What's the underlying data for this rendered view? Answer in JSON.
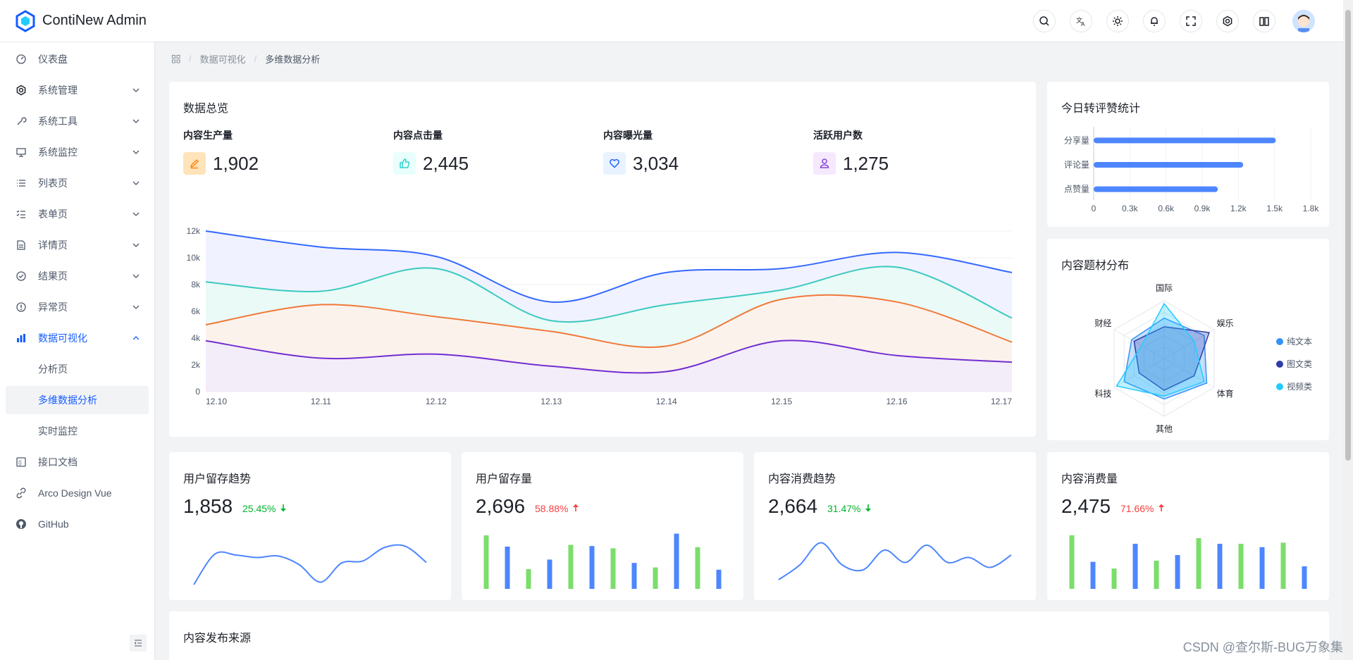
{
  "app": {
    "title": "ContiNew Admin"
  },
  "header": {
    "icons": [
      "search-icon",
      "translate-icon",
      "theme-icon",
      "bell-icon",
      "fullscreen-icon",
      "gear-icon",
      "book-icon"
    ]
  },
  "sidebar": {
    "items": [
      {
        "label": "仪表盘",
        "icon": "dashboard-icon"
      },
      {
        "label": "系统管理",
        "icon": "gear-icon"
      },
      {
        "label": "系统工具",
        "icon": "wrench-icon"
      },
      {
        "label": "系统监控",
        "icon": "monitor-icon"
      },
      {
        "label": "列表页",
        "icon": "list-icon"
      },
      {
        "label": "表单页",
        "icon": "form-icon"
      },
      {
        "label": "详情页",
        "icon": "file-icon"
      },
      {
        "label": "结果页",
        "icon": "check-circle-icon"
      },
      {
        "label": "异常页",
        "icon": "exclamation-icon"
      },
      {
        "label": "数据可视化",
        "icon": "bar-chart-icon"
      },
      {
        "label": "分析页"
      },
      {
        "label": "多维数据分析"
      },
      {
        "label": "实时监控"
      },
      {
        "label": "接口文档",
        "icon": "api-icon"
      },
      {
        "label": "Arco Design Vue",
        "icon": "link-icon"
      },
      {
        "label": "GitHub",
        "icon": "github-icon"
      }
    ]
  },
  "breadcrumb": {
    "home_icon": "apps-icon",
    "level1": "数据可视化",
    "current": "多维数据分析"
  },
  "overview": {
    "title": "数据总览",
    "stats": [
      {
        "label": "内容生产量",
        "value": "1,902",
        "icon": "edit-icon",
        "color": "#ff7d00",
        "bg": "#ffe4ba"
      },
      {
        "label": "内容点击量",
        "value": "2,445",
        "icon": "thumb-up-icon",
        "color": "#14c9c9",
        "bg": "#e8fffb"
      },
      {
        "label": "内容曝光量",
        "value": "3,034",
        "icon": "heart-icon",
        "color": "#165dff",
        "bg": "#e8f3ff"
      },
      {
        "label": "活跃用户数",
        "value": "1,275",
        "icon": "user-icon",
        "color": "#722ed1",
        "bg": "#f5e8ff"
      }
    ]
  },
  "chart_data": [
    {
      "type": "area",
      "x": [
        "12.10",
        "12.11",
        "12.12",
        "12.13",
        "12.14",
        "12.15",
        "12.16",
        "12.17"
      ],
      "ylim": [
        0,
        12000
      ],
      "yticks": [
        "0",
        "2k",
        "4k",
        "6k",
        "8k",
        "10k",
        "12k"
      ],
      "series": [
        {
          "color": "#3469ff",
          "fill": "#eef0ff",
          "values": [
            12000,
            10800,
            10100,
            6700,
            8900,
            9200,
            10400,
            8900
          ]
        },
        {
          "color": "#3bc9c0",
          "fill": "#e8fbf6",
          "values": [
            8200,
            7500,
            9200,
            5300,
            6500,
            7600,
            9300,
            5500
          ]
        },
        {
          "color": "#f0793a",
          "fill": "#fff0ea",
          "values": [
            5000,
            6500,
            5600,
            4500,
            3400,
            6900,
            6700,
            3700
          ]
        },
        {
          "color": "#722ed1",
          "fill": "#f1ebfb",
          "values": [
            3800,
            2500,
            2800,
            1900,
            1500,
            3800,
            2700,
            2200
          ]
        }
      ],
      "grid": true
    },
    {
      "type": "bar",
      "title": "今日转评赞统计",
      "categories": [
        "分享量",
        "评论量",
        "点赞量"
      ],
      "values": [
        1510,
        1240,
        1030
      ],
      "xlim": [
        0,
        1800
      ],
      "xticks": [
        "0",
        "0.3k",
        "0.6k",
        "0.9k",
        "1.2k",
        "1.5k",
        "1.8k"
      ],
      "color": "#4d86ff"
    },
    {
      "type": "radar",
      "title": "内容题材分布",
      "axes": [
        "国际",
        "娱乐",
        "体育",
        "其他",
        "科技",
        "财经"
      ],
      "max": 100,
      "series": [
        {
          "name": "纯文本",
          "color": "#3491fa",
          "values": [
            70,
            80,
            85,
            70,
            80,
            65
          ]
        },
        {
          "name": "图文类",
          "color": "#313ca9",
          "values": [
            55,
            90,
            60,
            55,
            50,
            60
          ]
        },
        {
          "name": "视频类",
          "color": "#21ccff",
          "values": [
            95,
            60,
            80,
            65,
            95,
            45
          ]
        }
      ],
      "legend": "right"
    },
    {
      "type": "line",
      "title": "用户留存趋势",
      "values": [
        0,
        62,
        60,
        55,
        58,
        40,
        5,
        44,
        48,
        75,
        78,
        45
      ],
      "color": "#4d86ff"
    },
    {
      "type": "bar",
      "title": "用户留存量",
      "values": [
        95,
        75,
        35,
        52,
        78,
        76,
        72,
        46,
        38,
        98,
        74,
        34
      ],
      "colors": [
        "#7bde6b",
        "#4d86ff"
      ]
    },
    {
      "type": "line",
      "title": "内容消费趋势",
      "values": [
        10,
        40,
        85,
        40,
        30,
        70,
        45,
        80,
        45,
        55,
        35,
        60
      ],
      "color": "#4d86ff"
    },
    {
      "type": "bar",
      "title": "内容消费量",
      "values": [
        95,
        48,
        36,
        80,
        50,
        60,
        90,
        80,
        80,
        74,
        82,
        40
      ],
      "colors": [
        "#7bde6b",
        "#4d86ff"
      ]
    }
  ],
  "today_stats": {
    "title": "今日转评赞统计"
  },
  "topic_dist": {
    "title": "内容题材分布",
    "legend": [
      "纯文本",
      "图文类",
      "视频类"
    ]
  },
  "mini_cards": [
    {
      "title": "用户留存趋势",
      "value": "1,858",
      "pct": "25.45%",
      "dir": "down"
    },
    {
      "title": "用户留存量",
      "value": "2,696",
      "pct": "58.88%",
      "dir": "up"
    },
    {
      "title": "内容消费趋势",
      "value": "2,664",
      "pct": "31.47%",
      "dir": "down"
    },
    {
      "title": "内容消费量",
      "value": "2,475",
      "pct": "71.66%",
      "dir": "up"
    }
  ],
  "source_card": {
    "title": "内容发布来源"
  },
  "watermark": "CSDN @查尔斯-BUG万象集"
}
